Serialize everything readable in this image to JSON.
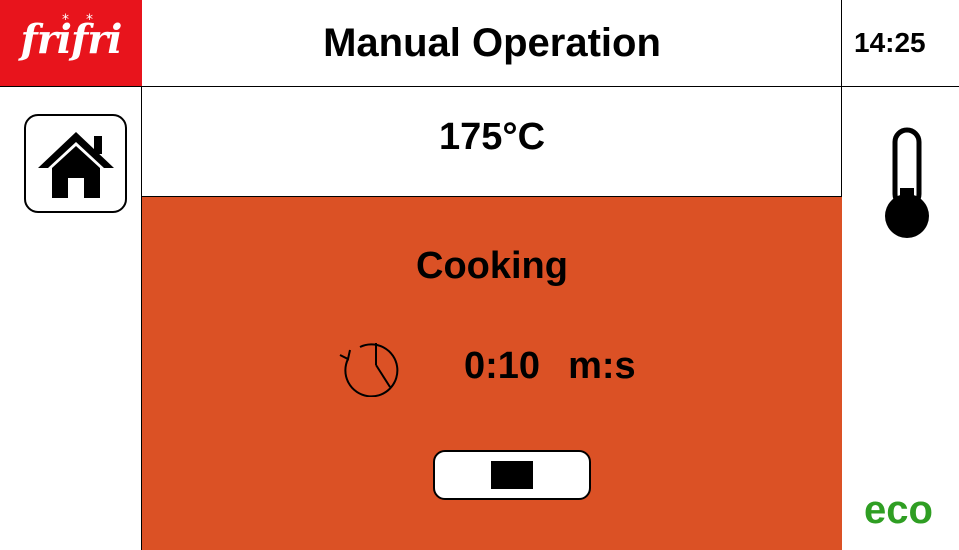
{
  "header": {
    "logo_text": "frifri",
    "title": "Manual Operation",
    "time": "14:25"
  },
  "temperature": {
    "value": "175°C"
  },
  "cooking": {
    "status": "Cooking",
    "timer_value": "0:10",
    "timer_unit": "m:s"
  },
  "mode": {
    "eco_label": "eco"
  },
  "icons": {
    "home": "home-icon",
    "thermometer": "thermometer-icon",
    "timer": "timer-icon",
    "stop": "stop-icon"
  },
  "colors": {
    "logo_bg": "#e8141c",
    "cooking_panel": "#db5125",
    "eco": "#2f9e23"
  }
}
